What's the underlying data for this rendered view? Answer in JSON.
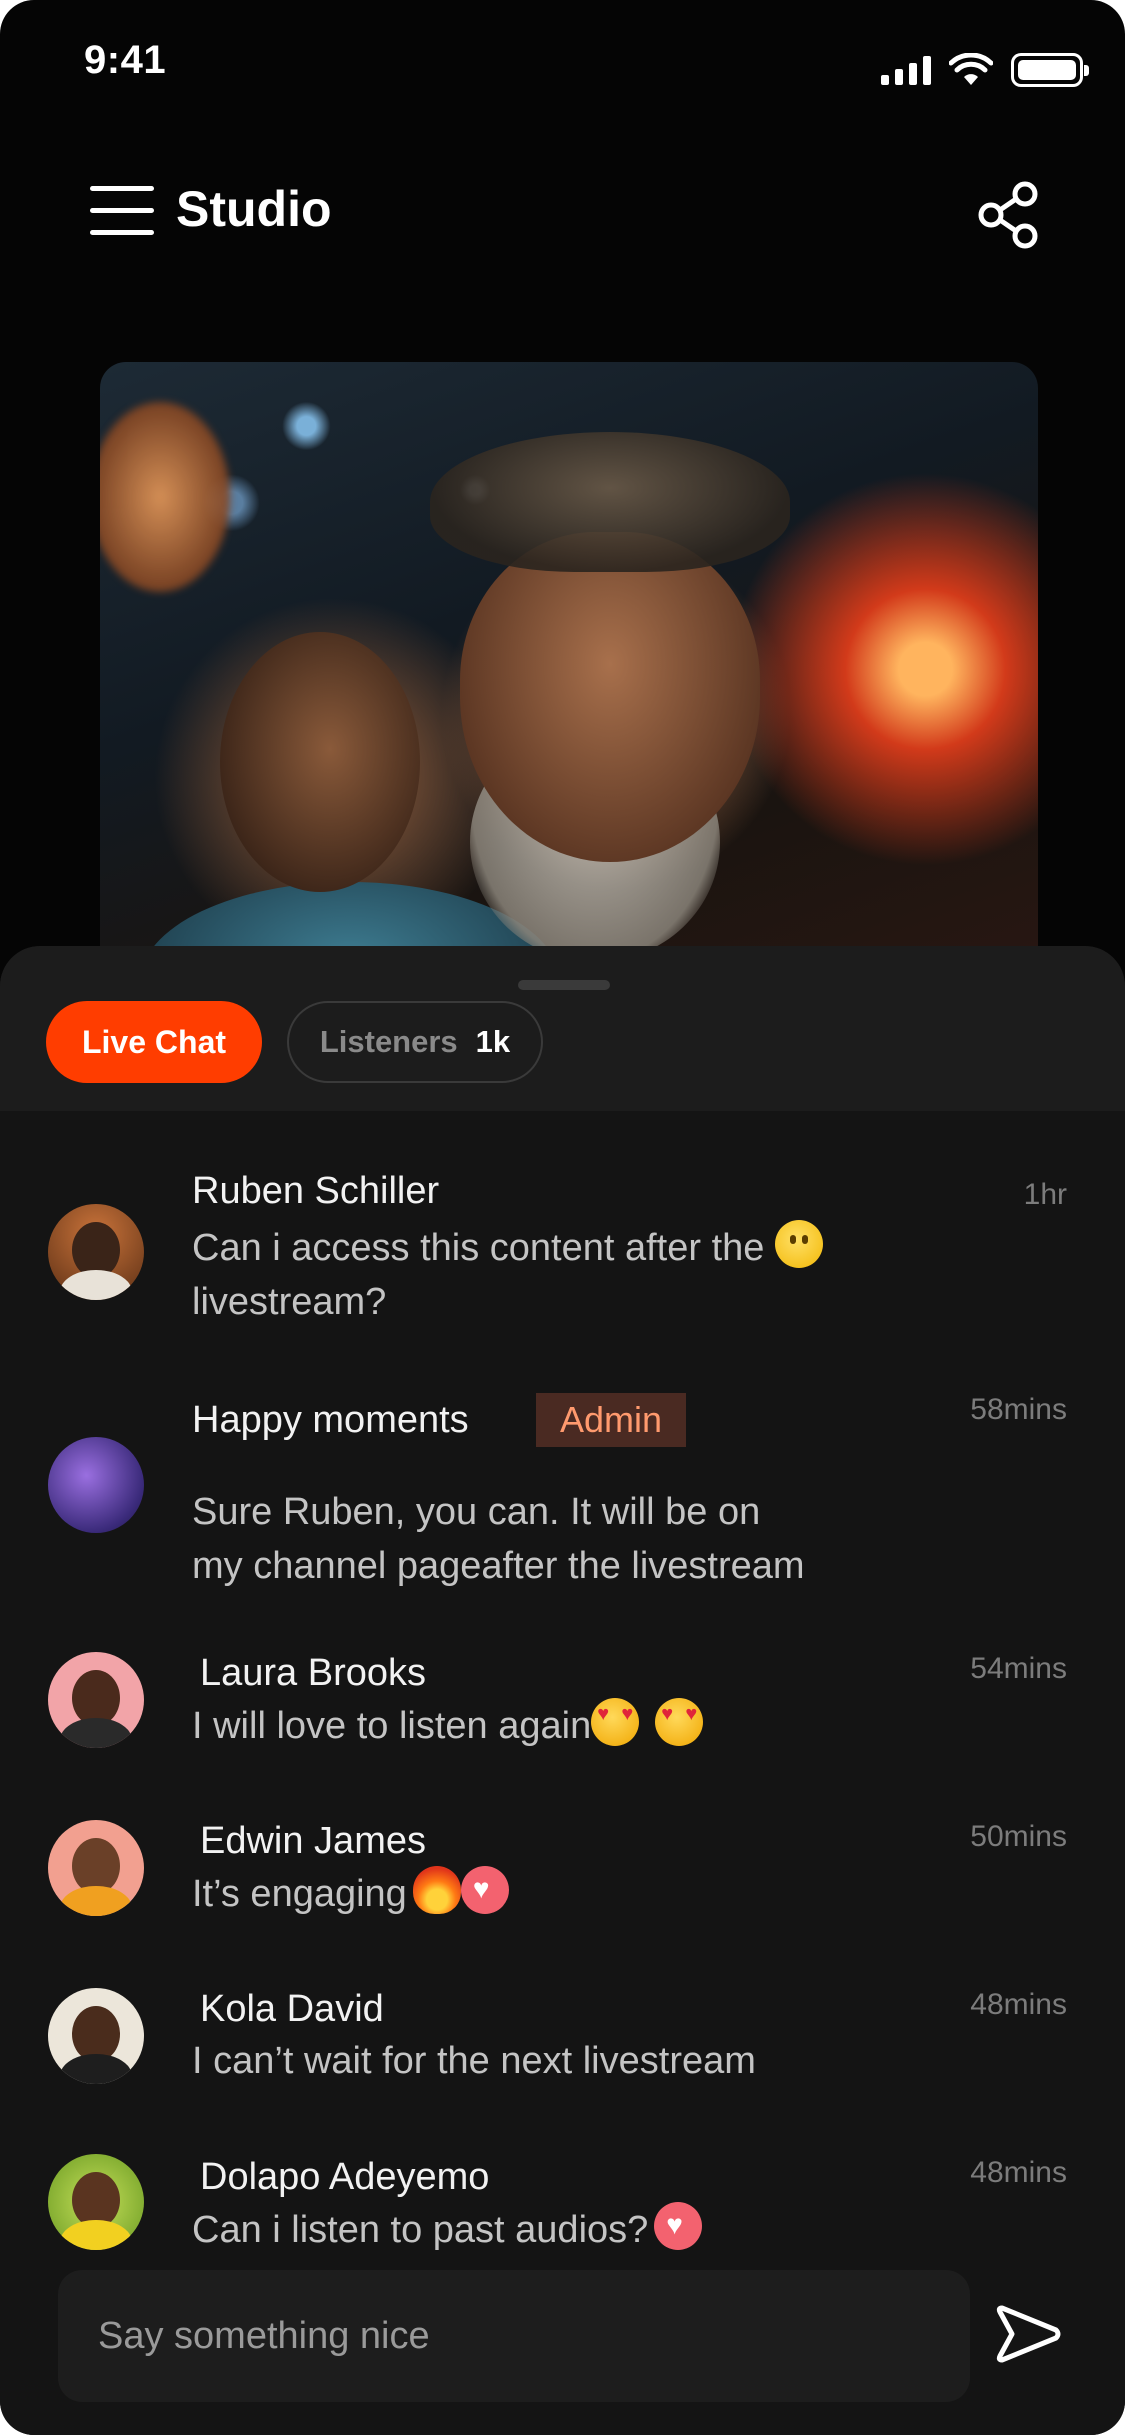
{
  "status_bar": {
    "time": "9:41"
  },
  "header": {
    "title": "Studio"
  },
  "chat": {
    "tabs": {
      "live_chat": "Live Chat",
      "listeners_label": "Listeners",
      "listeners_count": "1k"
    },
    "messages": [
      {
        "name": "Ruben Schiller",
        "time": "1hr",
        "text_line1": "Can i access this content after the",
        "text_line2": "livestream?",
        "emojis": [
          "slightly-smiling-face"
        ]
      },
      {
        "name": "Happy moments",
        "badge": "Admin",
        "time": "58mins",
        "text_line1": "Sure Ruben, you can. It will be on",
        "text_line2": "my channel pageafter the livestream"
      },
      {
        "name": "Laura Brooks",
        "time": "54mins",
        "text_line1": "I will love to listen again",
        "emojis": [
          "heart-eyes",
          "heart-eyes"
        ]
      },
      {
        "name": "Edwin James",
        "time": "50mins",
        "text_line1": "It’s engaging",
        "emojis": [
          "fire",
          "heart"
        ]
      },
      {
        "name": "Kola David",
        "time": "48mins",
        "text_line1": "I can’t wait for the next livestream"
      },
      {
        "name": "Dolapo Adeyemo",
        "time": "48mins",
        "text_line1": "Can i listen to past audios?",
        "emojis": [
          "heart"
        ]
      }
    ]
  },
  "composer": {
    "placeholder": "Say something nice"
  },
  "colors": {
    "accent": "#ff3d00",
    "background": "#050505",
    "sheet": "#141414",
    "admin_badge_bg": "#4a2a22",
    "admin_badge_text": "#ff9a6e"
  }
}
